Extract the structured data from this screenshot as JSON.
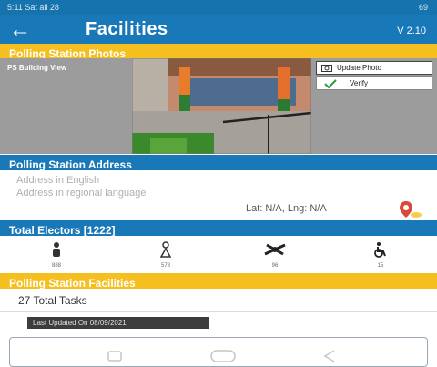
{
  "status_bar": {
    "left": "5:11 Sat ail 28",
    "right": "69"
  },
  "app_bar": {
    "back": "←",
    "title": "Facilities",
    "version": "V 2.10"
  },
  "photos": {
    "header": "Polling Station Photos",
    "photo_label": "PS Building View",
    "update_label": "Update Photo",
    "verify_label": "Verify"
  },
  "address": {
    "header": "Polling Station Address",
    "english": "Address in English",
    "regional": "Address in regional language",
    "latlng": "Lat: N/A, Lng: N/A"
  },
  "electors": {
    "header": "Total Electors [1222]",
    "categories": [
      {
        "icon": "male-voter-icon",
        "label": "888"
      },
      {
        "icon": "female-voter-icon",
        "label": "578"
      },
      {
        "icon": "third-gender-icon",
        "label": "96"
      },
      {
        "icon": "pwd-wheelchair-icon",
        "label": "15"
      }
    ]
  },
  "facilities": {
    "header": "Polling Station Facilities",
    "tasks": "27 Total Tasks"
  },
  "last_updated": "Last Updated On 08/09/2021",
  "colors": {
    "primary": "#1878b8",
    "accent": "#f4bf1f",
    "pin": "#d84b3a"
  }
}
